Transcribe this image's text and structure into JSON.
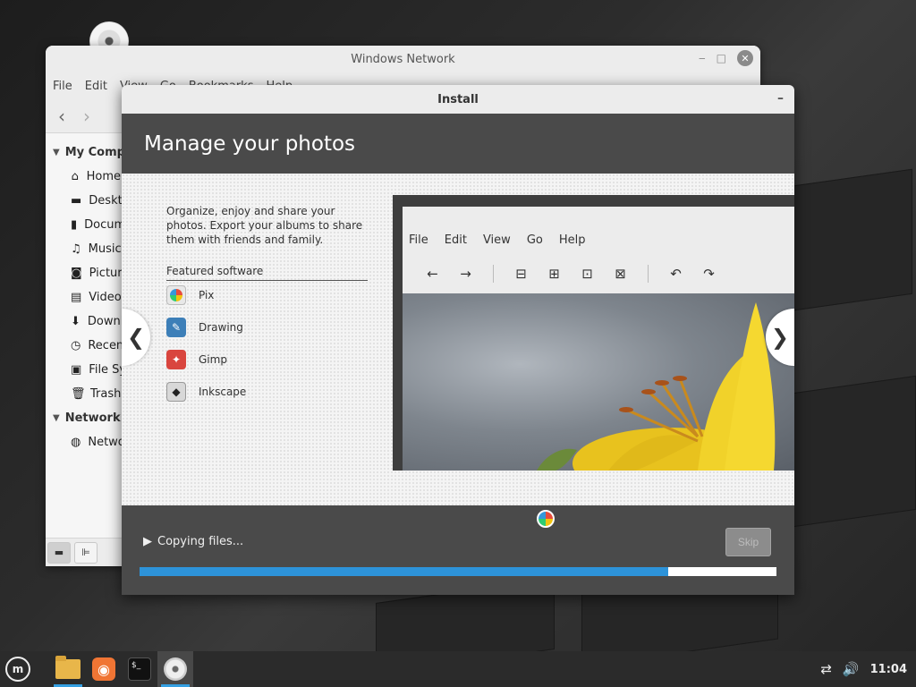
{
  "file_manager": {
    "title": "Windows Network",
    "menu": [
      "File",
      "Edit",
      "View",
      "Go",
      "Bookmarks",
      "Help"
    ],
    "sidebar": {
      "computer_section": "My Computer",
      "computer_items": [
        "Home",
        "Desktop",
        "Documents",
        "Music",
        "Pictures",
        "Videos",
        "Downloads",
        "Recent",
        "File System",
        "Trash"
      ],
      "network_section": "Network",
      "network_items": [
        "Network"
      ]
    }
  },
  "installer": {
    "title": "Install",
    "heading": "Manage your photos",
    "description": "Organize, enjoy and share your photos. Export your albums to share them with friends and family.",
    "featured_label": "Featured software",
    "software": [
      "Pix",
      "Drawing",
      "Gimp",
      "Inkscape"
    ],
    "screenshot_menu": [
      "File",
      "Edit",
      "View",
      "Go",
      "Help"
    ],
    "status": "Copying files...",
    "skip_label": "Skip",
    "progress": 0.83
  },
  "taskbar": {
    "clock": "11:04"
  }
}
